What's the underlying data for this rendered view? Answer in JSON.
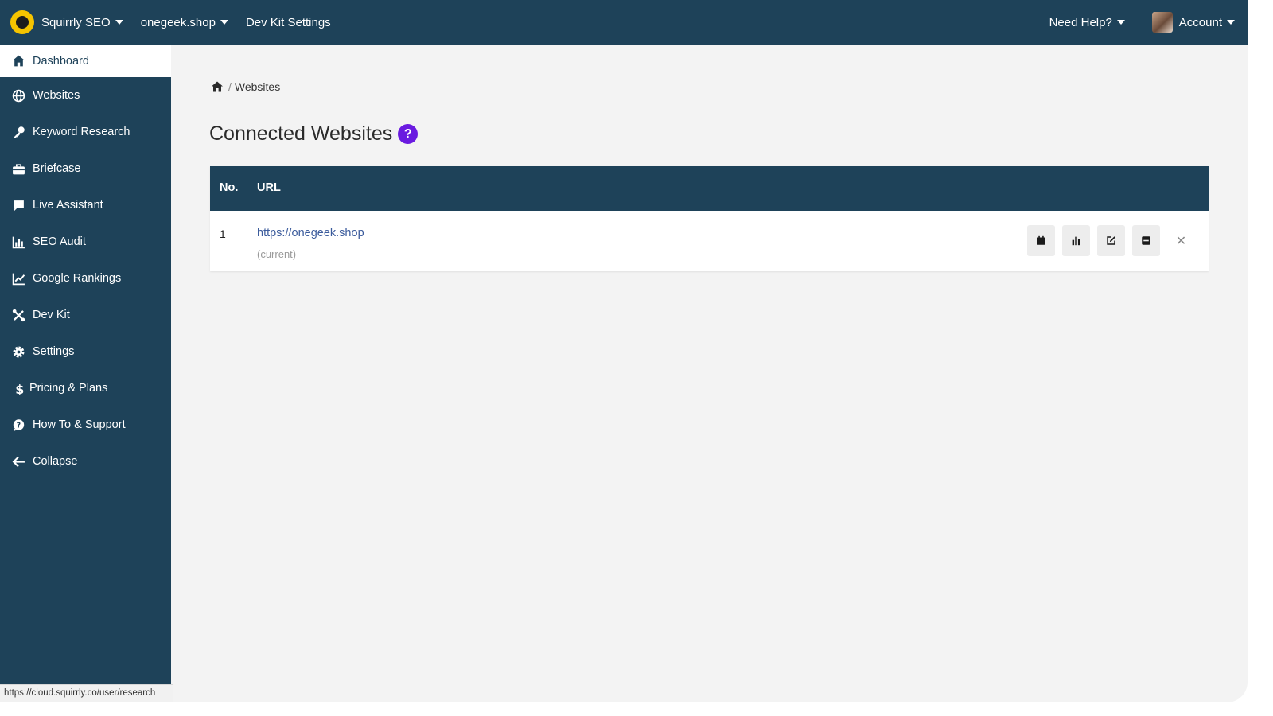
{
  "topbar": {
    "brand": "Squirrly SEO",
    "site": "onegeek.shop",
    "devkit": "Dev Kit Settings",
    "help": "Need Help?",
    "account": "Account"
  },
  "sidebar": {
    "items": [
      {
        "label": "Dashboard",
        "icon": "home-icon"
      },
      {
        "label": "Websites",
        "icon": "globe-icon"
      },
      {
        "label": "Keyword Research",
        "icon": "key-icon"
      },
      {
        "label": "Briefcase",
        "icon": "briefcase-icon"
      },
      {
        "label": "Live Assistant",
        "icon": "comment-icon"
      },
      {
        "label": "SEO Audit",
        "icon": "bar-chart-icon"
      },
      {
        "label": "Google Rankings",
        "icon": "line-chart-icon"
      },
      {
        "label": "Dev Kit",
        "icon": "tools-icon"
      },
      {
        "label": "Settings",
        "icon": "gear-icon"
      },
      {
        "label": "Pricing & Plans",
        "icon": "dollar-icon"
      },
      {
        "label": "How To & Support",
        "icon": "support-icon"
      },
      {
        "label": "Collapse",
        "icon": "arrow-left-icon"
      }
    ]
  },
  "breadcrumb": {
    "current": "Websites",
    "sep": "/"
  },
  "main": {
    "title": "Connected Websites",
    "help": "?",
    "table": {
      "col_no": "No.",
      "col_url": "URL",
      "rows": [
        {
          "no": "1",
          "url": "https://onegeek.shop",
          "note": "(current)"
        }
      ]
    }
  },
  "statusbar": {
    "url": "https://cloud.squirrly.co/user/research"
  },
  "colors": {
    "navy": "#1e4259",
    "accent": "#6a1be0",
    "brand_yellow": "#f5c400"
  }
}
